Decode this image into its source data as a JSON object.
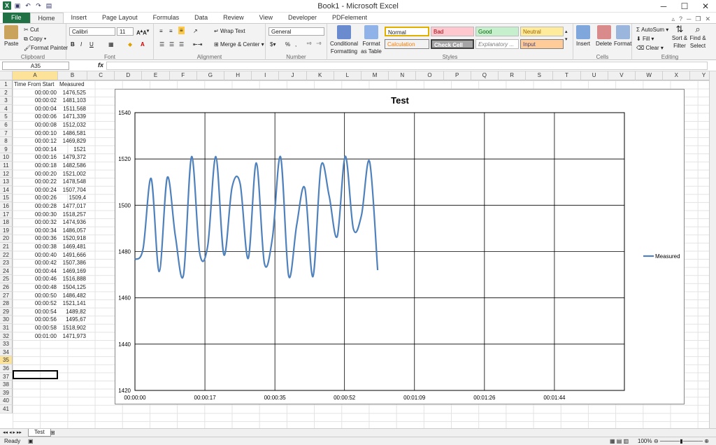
{
  "window": {
    "title": "Book1 - Microsoft Excel"
  },
  "tabs": [
    {
      "label": "File"
    },
    {
      "label": "Home"
    },
    {
      "label": "Insert"
    },
    {
      "label": "Page Layout"
    },
    {
      "label": "Formulas"
    },
    {
      "label": "Data"
    },
    {
      "label": "Review"
    },
    {
      "label": "View"
    },
    {
      "label": "Developer"
    },
    {
      "label": "PDFelement"
    }
  ],
  "ribbon": {
    "clipboard": {
      "paste": "Paste",
      "cut": "Cut",
      "copy": "Copy",
      "format_painter": "Format Painter",
      "label": "Clipboard"
    },
    "font": {
      "name": "Calibri",
      "size": "11",
      "label": "Font",
      "bold": "B",
      "italic": "I",
      "underline": "U"
    },
    "alignment": {
      "wrap": "Wrap Text",
      "merge": "Merge & Center",
      "label": "Alignment"
    },
    "number": {
      "format": "General",
      "label": "Number",
      "percent": "%"
    },
    "styles": {
      "conditional": "Conditional Formatting",
      "format_table": "Format as Table",
      "normal": "Normal",
      "bad": "Bad",
      "good": "Good",
      "neutral": "Neutral",
      "calculation": "Calculation",
      "check_cell": "Check Cell",
      "explanatory": "Explanatory ...",
      "input": "Input",
      "label": "Styles"
    },
    "cells": {
      "insert": "Insert",
      "delete": "Delete",
      "format": "Format",
      "label": "Cells"
    },
    "editing": {
      "autosum": "AutoSum",
      "fill": "Fill",
      "clear": "Clear",
      "sort": "Sort & Filter",
      "find": "Find & Select",
      "label": "Editing"
    }
  },
  "formula_bar": {
    "name_box": "A35",
    "fx": "fx",
    "value": ""
  },
  "columns": [
    "A",
    "B",
    "C",
    "D",
    "E",
    "F",
    "G",
    "H",
    "I",
    "J",
    "K",
    "L",
    "M",
    "N",
    "O",
    "P",
    "Q",
    "R",
    "S",
    "T",
    "U",
    "V",
    "W",
    "X",
    "Y"
  ],
  "sheet": {
    "headers": [
      "Time From Start",
      "Measured"
    ],
    "rows": [
      [
        "00:00:00",
        "1476,525"
      ],
      [
        "00:00:02",
        "1481,103"
      ],
      [
        "00:00:04",
        "1511,568"
      ],
      [
        "00:00:06",
        "1471,339"
      ],
      [
        "00:00:08",
        "1512,032"
      ],
      [
        "00:00:10",
        "1486,581"
      ],
      [
        "00:00:12",
        "1469,829"
      ],
      [
        "00:00:14",
        "1521"
      ],
      [
        "00:00:16",
        "1479,372"
      ],
      [
        "00:00:18",
        "1482,586"
      ],
      [
        "00:00:20",
        "1521,002"
      ],
      [
        "00:00:22",
        "1478,548"
      ],
      [
        "00:00:24",
        "1507,704"
      ],
      [
        "00:00:26",
        "1509,4"
      ],
      [
        "00:00:28",
        "1477,017"
      ],
      [
        "00:00:30",
        "1518,257"
      ],
      [
        "00:00:32",
        "1474,936"
      ],
      [
        "00:00:34",
        "1486,057"
      ],
      [
        "00:00:36",
        "1520,918"
      ],
      [
        "00:00:38",
        "1469,481"
      ],
      [
        "00:00:40",
        "1491,666"
      ],
      [
        "00:00:42",
        "1507,386"
      ],
      [
        "00:00:44",
        "1469,169"
      ],
      [
        "00:00:46",
        "1516,888"
      ],
      [
        "00:00:48",
        "1504,125"
      ],
      [
        "00:00:50",
        "1486,482"
      ],
      [
        "00:00:52",
        "1521,141"
      ],
      [
        "00:00:54",
        "1489,82"
      ],
      [
        "00:00:56",
        "1495,67"
      ],
      [
        "00:00:58",
        "1518,902"
      ],
      [
        "00:01:00",
        "1471,973"
      ]
    ],
    "row_count": 41,
    "selected_row": 35
  },
  "chart_data": {
    "type": "line",
    "title": "Test",
    "x": [
      0,
      2,
      4,
      6,
      8,
      10,
      12,
      14,
      16,
      18,
      20,
      22,
      24,
      26,
      28,
      30,
      32,
      34,
      36,
      38,
      40,
      42,
      44,
      46,
      48,
      50,
      52,
      54,
      56,
      58,
      60
    ],
    "series": [
      {
        "name": "Measured",
        "values": [
          1476.525,
          1481.103,
          1511.568,
          1471.339,
          1512.032,
          1486.581,
          1469.829,
          1521,
          1479.372,
          1482.586,
          1521.002,
          1478.548,
          1507.704,
          1509.4,
          1477.017,
          1518.257,
          1474.936,
          1486.057,
          1520.918,
          1469.481,
          1491.666,
          1507.386,
          1469.169,
          1516.888,
          1504.125,
          1486.482,
          1521.141,
          1489.82,
          1495.67,
          1518.902,
          1471.973
        ]
      }
    ],
    "xticks": [
      "00:00:00",
      "00:00:17",
      "00:00:35",
      "00:00:52",
      "00:01:09",
      "00:01:26",
      "00:01:44"
    ],
    "xtick_seconds": [
      0,
      17.3,
      34.6,
      51.8,
      69.1,
      86.4,
      103.7
    ],
    "xlim": [
      0,
      121
    ],
    "ylim": [
      1420,
      1540
    ],
    "yticks": [
      1420,
      1440,
      1460,
      1480,
      1500,
      1520,
      1540
    ],
    "legend": "right",
    "grid": true,
    "color": "#4f81bd"
  },
  "sheet_tab": "Test",
  "status": {
    "ready": "Ready",
    "zoom": "100%"
  }
}
